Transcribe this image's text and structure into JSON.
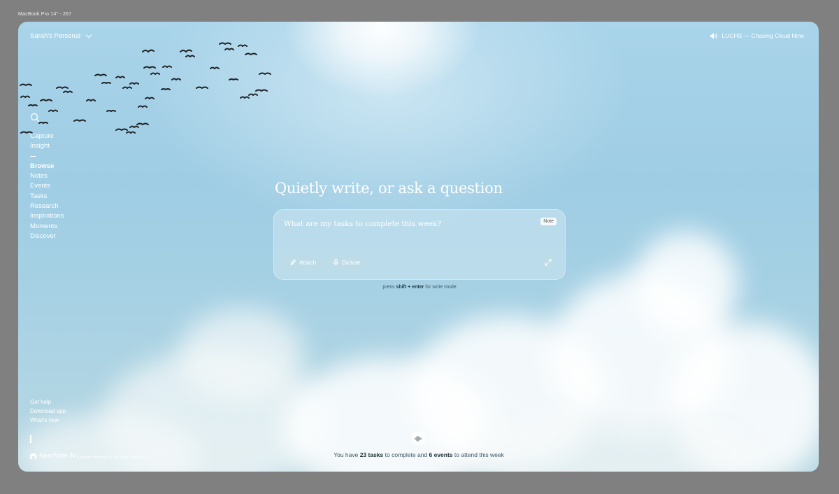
{
  "device_label": "MacBook Pro 14\" - 267",
  "workspace": {
    "name": "Sarah's Personal",
    "chevron_icon": "chevron-down-icon"
  },
  "now_playing": {
    "icon": "speaker-icon",
    "text": "LUCHS — Chasing Cloud Nine"
  },
  "search": {
    "icon": "search-icon"
  },
  "nav": {
    "primary": [
      "Capture",
      "Insight"
    ],
    "browse_heading": "Browse",
    "items": [
      "Notes",
      "Events",
      "Tasks",
      "Research",
      "Inspirations",
      "Moments",
      "Discover"
    ]
  },
  "bottom_links": [
    "Get help",
    "Download app",
    "What's new"
  ],
  "brand": {
    "name": "NearNote AI",
    "copyright": "Copyright NearNote AI. All Rights Reserved"
  },
  "composer": {
    "headline": "Quietly write, or ask a question",
    "placeholder": "What are my tasks to complete this week?",
    "mode_badge": "Note",
    "attach_label": "Attach",
    "dictate_label": "Dictate"
  },
  "hint": {
    "prefix": "press",
    "keys": "shift + enter",
    "suffix": "for write mode"
  },
  "status": {
    "prefix": "You have",
    "tasks": "23 tasks",
    "middle": "to complete and",
    "events": "6 events",
    "suffix": "to attend this week"
  },
  "colors": {
    "frame_bg": "#808080",
    "sky": "#a9d4ea",
    "text": "#ffffff",
    "status_text": "#3f5563"
  }
}
